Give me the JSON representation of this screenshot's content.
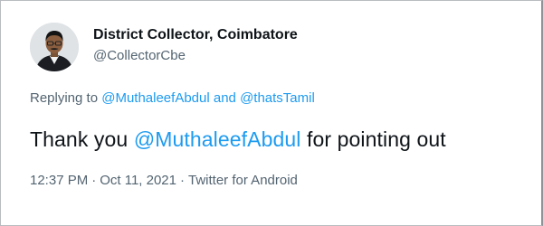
{
  "author": {
    "display_name": "District Collector, Coimbatore",
    "handle": "@CollectorCbe",
    "avatar_icon": "profile-photo"
  },
  "reply": {
    "prefix": "Replying to",
    "mention_1": "@MuthaleefAbdul",
    "conjunction": "and",
    "mention_2": "@thatsTamil"
  },
  "tweet": {
    "text_before": "Thank you",
    "mention": "@MuthaleefAbdul",
    "text_after": "for pointing out"
  },
  "meta": {
    "time": "12:37 PM",
    "separator": "·",
    "date": "Oct 11, 2021",
    "source": "Twitter for Android"
  },
  "colors": {
    "link": "#1d9bf0",
    "text": "#0f1419",
    "secondary": "#536471"
  }
}
